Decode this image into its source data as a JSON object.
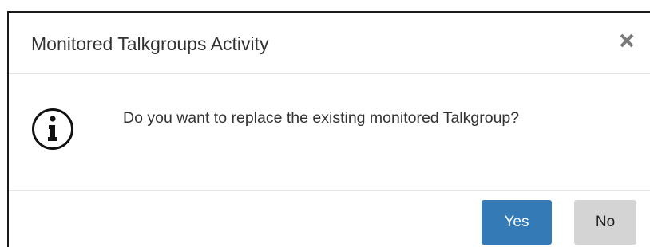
{
  "dialog": {
    "title": "Monitored Talkgroups Activity",
    "close_icon": "close-icon",
    "info_icon": "info-circle-icon",
    "message": "Do you want to replace the existing monitored Talkgroup?",
    "buttons": {
      "yes_label": "Yes",
      "no_label": "No"
    }
  },
  "colors": {
    "primary_button": "#337ab7",
    "secondary_button": "#d4d4d4",
    "text": "#333333",
    "divider": "#e5e5e5"
  }
}
